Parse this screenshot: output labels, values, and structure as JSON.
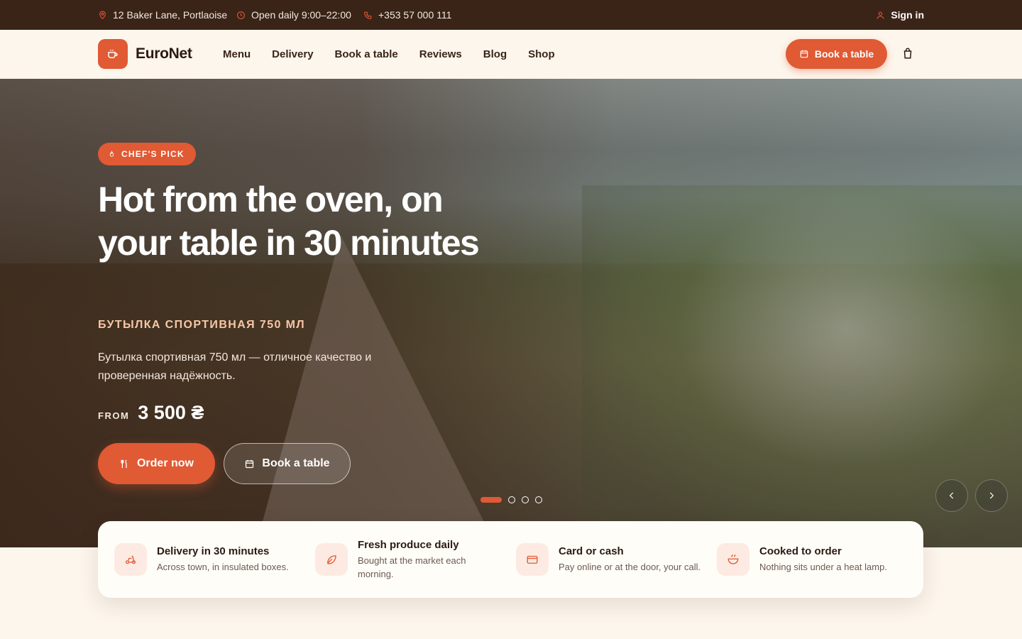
{
  "topbar": {
    "address": "12 Baker Lane, Portlaoise",
    "hours": "Open daily 9:00–22:00",
    "phone": "+353 57 000 111",
    "signin": "Sign in"
  },
  "header": {
    "brand": "EuroNet",
    "nav": [
      "Menu",
      "Delivery",
      "Book a table",
      "Reviews",
      "Blog",
      "Shop"
    ],
    "book_button": "Book a table"
  },
  "hero": {
    "badge": "CHEF'S PICK",
    "title": "Hot from the oven, on your table in 30 minutes",
    "subtitle": "БУТЫЛКА СПОРТИВНАЯ 750 МЛ",
    "description": "Бутылка спортивная 750 мл — отличное качество и проверенная надёжность.",
    "price_prefix": "FROM",
    "price": "3 500 ₴",
    "order_button": "Order now",
    "book_button": "Book a table",
    "slides": 4,
    "active_slide": 1
  },
  "features": [
    {
      "title": "Delivery in 30 minutes",
      "desc": "Across town, in insulated boxes.",
      "icon": "scooter-icon"
    },
    {
      "title": "Fresh produce daily",
      "desc": "Bought at the market each morning.",
      "icon": "leaf-icon"
    },
    {
      "title": "Card or cash",
      "desc": "Pay online or at the door, your call.",
      "icon": "card-icon"
    },
    {
      "title": "Cooked to order",
      "desc": "Nothing sits under a heat lamp.",
      "icon": "bowl-icon"
    }
  ],
  "colors": {
    "accent": "#e05a34",
    "dark": "#3a2418",
    "cream": "#fdf6ec"
  }
}
